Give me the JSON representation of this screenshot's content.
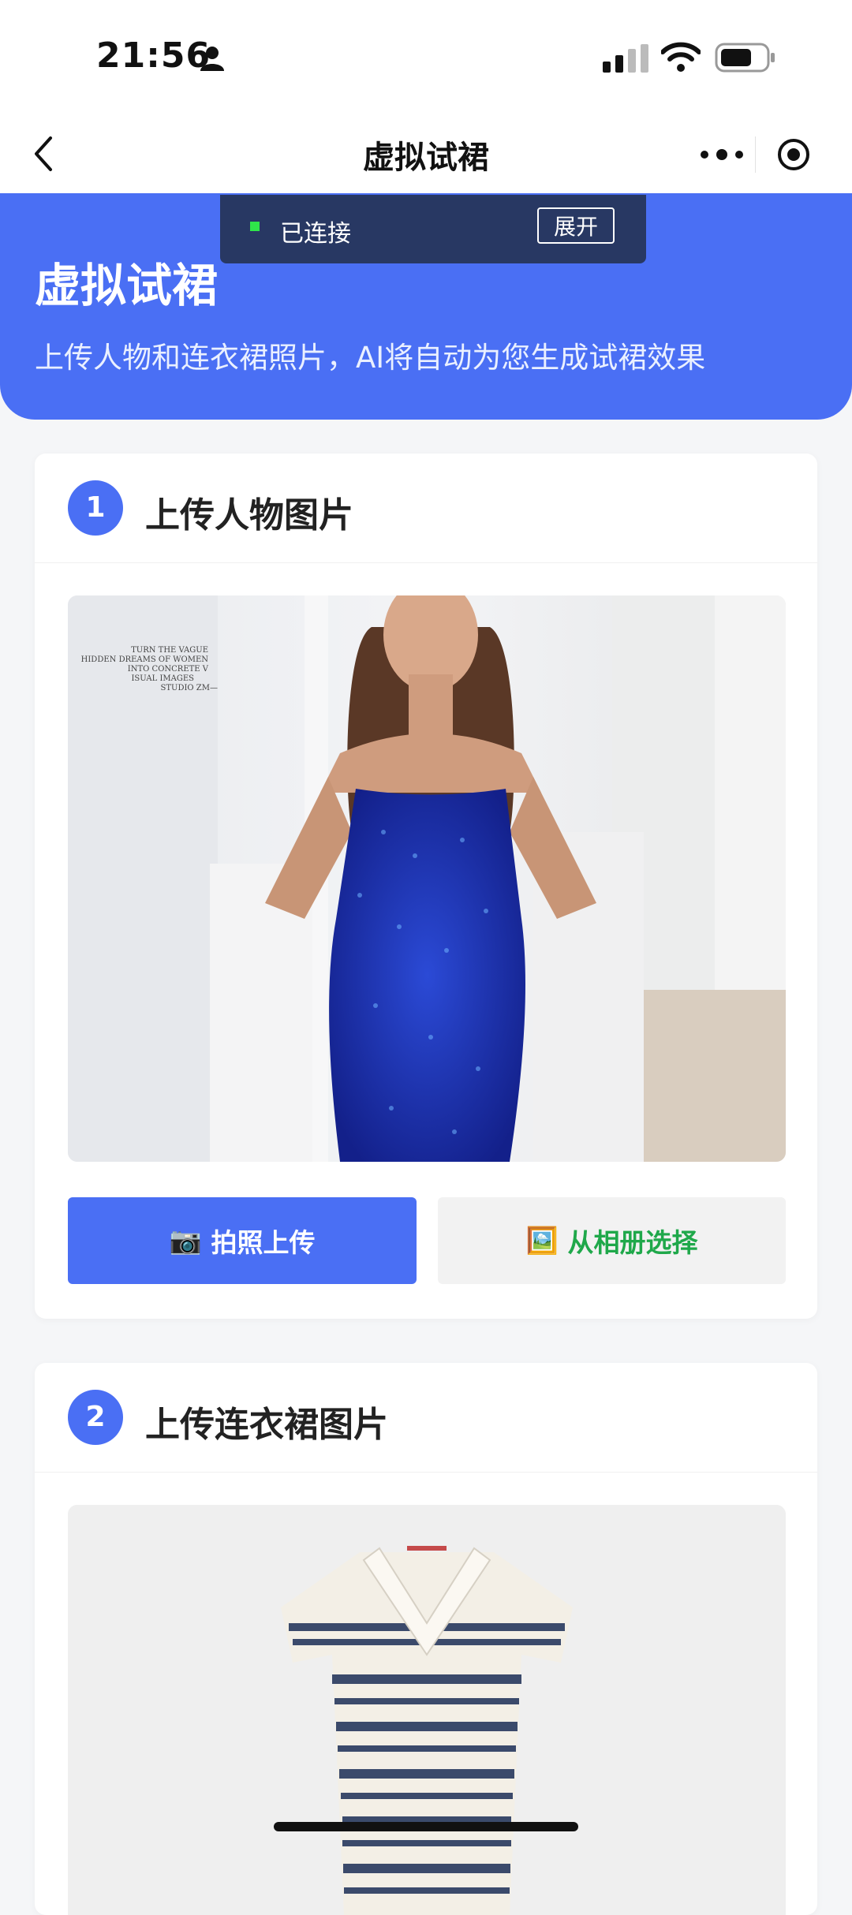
{
  "status_bar": {
    "time": "21:56"
  },
  "nav": {
    "title": "虚拟试裙"
  },
  "toast": {
    "status": "已连接",
    "expand_label": "展开"
  },
  "header": {
    "title": "虚拟试裙",
    "subtitle": "上传人物和连衣裙照片，AI将自动为您生成试裙效果"
  },
  "steps": [
    {
      "number": "1",
      "title": "上传人物图片"
    },
    {
      "number": "2",
      "title": "上传连衣裙图片"
    }
  ],
  "buttons": {
    "camera_icon": "📷",
    "camera_label": "拍照上传",
    "album_icon": "🖼️",
    "album_label": "从相册选择"
  },
  "photo_overlay_text": [
    "TURN THE VAGUE",
    "HIDDEN DREAMS OF WOMEN",
    "INTO CONCRETE V",
    "ISUAL IMAGES",
    "STUDIO ZM—"
  ],
  "colors": {
    "accent": "#4a6ff4",
    "toast_bg": "#283863",
    "connected": "#2fe64a",
    "album_text": "#1fa84a"
  }
}
